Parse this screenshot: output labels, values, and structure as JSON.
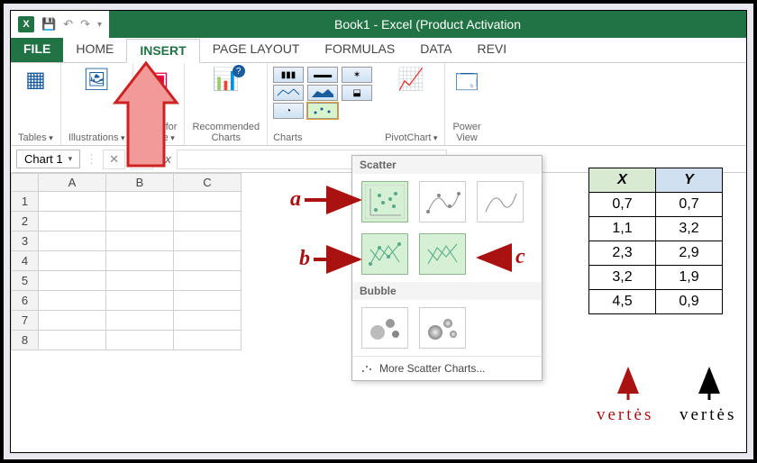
{
  "title": "Book1 - Excel (Product Activation",
  "tabs": {
    "file": "FILE",
    "home": "HOME",
    "insert": "INSERT",
    "pagelayout": "PAGE LAYOUT",
    "formulas": "FORMULAS",
    "data": "DATA",
    "review": "REVI"
  },
  "ribbon": {
    "tables": "Tables",
    "illustrations": "Illustrations",
    "apps": "Apps for\nOffice",
    "recommended": "Recommended\nCharts",
    "charts": "Charts",
    "pivot": "PivotChart",
    "power": "Power\nView"
  },
  "namebox": "Chart 1",
  "columns": [
    "A",
    "B",
    "C"
  ],
  "rows": [
    1,
    2,
    3,
    4,
    5,
    6,
    7,
    8
  ],
  "dropdown": {
    "scatter": "Scatter",
    "bubble": "Bubble",
    "more": "More Scatter Charts..."
  },
  "letters": {
    "a": "a",
    "b": "b",
    "c": "c"
  },
  "datatable": {
    "xh": "X",
    "yh": "Y",
    "rows": [
      {
        "x": "0,7",
        "y": "0,7"
      },
      {
        "x": "1,1",
        "y": "3,2"
      },
      {
        "x": "2,3",
        "y": "2,9"
      },
      {
        "x": "3,2",
        "y": "1,9"
      },
      {
        "x": "4,5",
        "y": "0,9"
      }
    ]
  },
  "labels": {
    "vertes": "vertės"
  }
}
